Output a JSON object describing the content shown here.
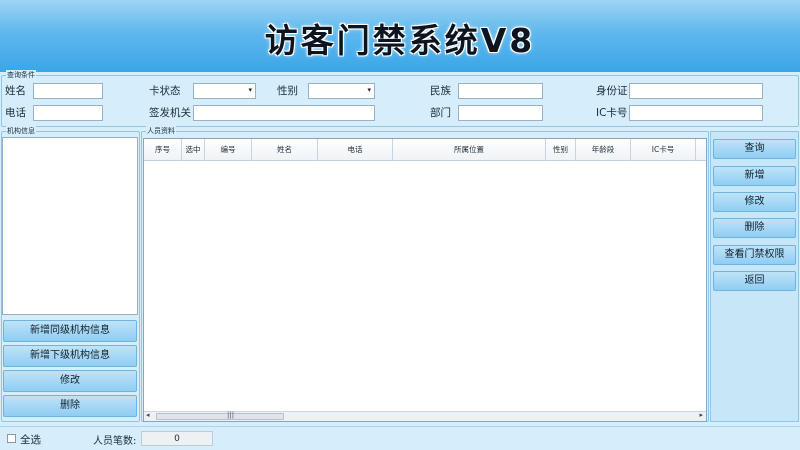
{
  "app_title": "访客门禁系统V8",
  "query": {
    "group_title": "查询条件",
    "name_label": "姓名",
    "card_status_label": "卡状态",
    "gender_label": "性别",
    "ethnicity_label": "民族",
    "id_card_label": "身份证",
    "phone_label": "电话",
    "issuer_label": "签发机关",
    "department_label": "部门",
    "ic_card_label": "IC卡号"
  },
  "org": {
    "group_title": "机构信息",
    "add_same_level_label": "新增同级机构信息",
    "add_sub_level_label": "新增下级机构信息",
    "edit_label": "修改",
    "delete_label": "删除"
  },
  "grid": {
    "group_title": "人员资料",
    "columns": [
      "序号",
      "选中",
      "编号",
      "姓名",
      "电话",
      "所属位置",
      "性别",
      "年龄段",
      "IC卡号"
    ],
    "grip_glyph": "|||",
    "left_arrow": "◂",
    "right_arrow": "▸"
  },
  "actions": {
    "query_label": "查询",
    "add_label": "新增",
    "edit_label": "修改",
    "delete_label": "删除",
    "view_permissions_label": "查看门禁权限",
    "back_label": "返回"
  },
  "footer": {
    "select_all_label": "全选",
    "count_label": "人员笔数:",
    "count_value": "0"
  },
  "colors": {
    "header_top": "#9fd4f3",
    "header_bottom": "#3aa6e7",
    "panel_bg": "#d6eefb",
    "button_top": "#bfe3f8",
    "button_bottom": "#8fcdf2"
  }
}
